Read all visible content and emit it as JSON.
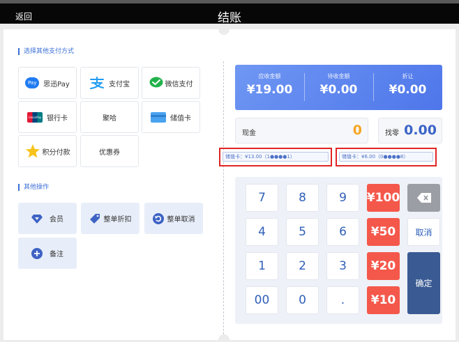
{
  "header": {
    "back_label": "返回",
    "title": "结账"
  },
  "sections": {
    "other_payment": "选择其他支付方式",
    "other_ops": "其他操作"
  },
  "payment_methods": [
    {
      "label": "思迅Pay",
      "badge": "Pay",
      "icon": "sixun-pay-icon"
    },
    {
      "label": "支付宝",
      "icon": "alipay-icon"
    },
    {
      "label": "微信支付",
      "icon": "wechat-pay-icon"
    },
    {
      "label": "银行卡",
      "badge": "UnionPay",
      "icon": "unionpay-icon"
    },
    {
      "label": "聚哈",
      "icon": ""
    },
    {
      "label": "储值卡",
      "icon": "stored-card-icon"
    },
    {
      "label": "积分付款",
      "icon": "points-star-icon"
    },
    {
      "label": "优惠券",
      "icon": ""
    }
  ],
  "operations": [
    {
      "label": "会员",
      "icon": "member-diamond-icon"
    },
    {
      "label": "整单折扣",
      "icon": "discount-tag-icon"
    },
    {
      "label": "整单取消",
      "icon": "undo-icon"
    },
    {
      "label": "备注",
      "icon": "plus-circle-icon"
    }
  ],
  "summary": {
    "receivable_label": "应收金额",
    "receivable_value": "¥19.00",
    "pending_label": "待收金额",
    "pending_value": "¥0.00",
    "discount_label": "折让",
    "discount_value": "¥0.00"
  },
  "cash": {
    "label": "现金",
    "value": "0"
  },
  "change": {
    "label": "找零",
    "value": "0.00"
  },
  "stored_card_records": [
    "储值卡：¥13.00（1●●●●1）",
    "储值卡：¥6.00（0●●●●8）"
  ],
  "keypad": {
    "digits": [
      "7",
      "8",
      "9",
      "4",
      "5",
      "6",
      "1",
      "2",
      "3",
      "00",
      "0",
      "."
    ],
    "quick_amounts": [
      "¥100",
      "¥50",
      "¥20",
      "¥10"
    ],
    "cancel_label": "取消",
    "confirm_label": "确定"
  },
  "colors": {
    "accent": "#3b6fd6",
    "banner": "#5b82ee",
    "quick_amount": "#f4584b",
    "confirm": "#3a5a93",
    "cash_value": "#f5a623",
    "highlight": "#e02424"
  }
}
